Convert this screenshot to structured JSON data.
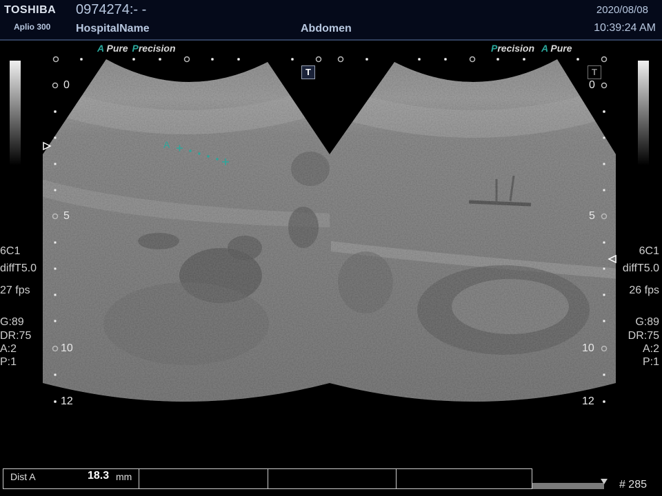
{
  "header": {
    "brand": "TOSHIBA",
    "model": "Aplio 300",
    "patient_id": "0974274:- -",
    "hospital": "HospitalName",
    "exam": "Abdomen",
    "date": "2020/08/08",
    "time": "10:39:24 AM"
  },
  "left_panel": {
    "badge_a": "A",
    "badge_pure": "Pure",
    "badge_p": "P",
    "badge_precision": "recision",
    "t_label": "T",
    "depth_labels": {
      "d0": "0",
      "d5": "5",
      "d10": "10",
      "d12": "12"
    },
    "params": {
      "probe": "6C1",
      "preset": "diffT5.0",
      "fps": "27 fps",
      "gain": "G:89",
      "dr": "DR:75",
      "a": "A:2",
      "p": "P:1"
    },
    "measure_marker": "A"
  },
  "right_panel": {
    "badge_p": "P",
    "badge_precision": "recision",
    "badge_a": "A",
    "badge_pure": "Pure",
    "t_label": "T",
    "depth_labels": {
      "d0": "0",
      "d5": "5",
      "d10": "10",
      "d12": "12"
    },
    "params": {
      "probe": "6C1",
      "preset": "diffT5.0",
      "fps": "26 fps",
      "gain": "G:89",
      "dr": "DR:75",
      "a": "A:2",
      "p": "P:1"
    }
  },
  "measurement": {
    "label": "Dist A",
    "value": "18.3",
    "unit": "mm"
  },
  "frame": "# 285",
  "colors": {
    "accent": "#2aa79c",
    "header_bg": "#050a1a",
    "header_border": "#31405e"
  }
}
